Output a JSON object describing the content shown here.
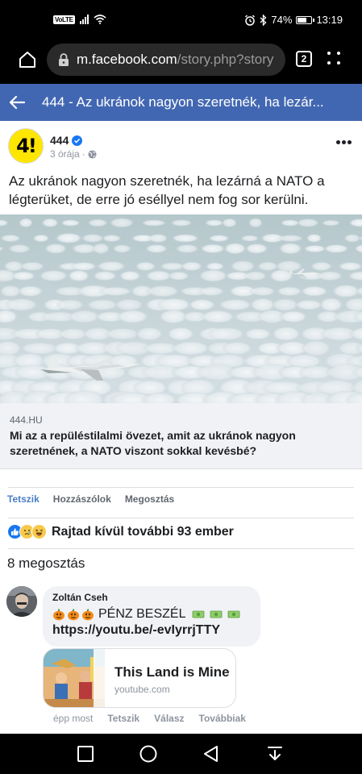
{
  "status_bar": {
    "volte": "VoLTE",
    "battery_text": "74%",
    "battery_level": 0.74,
    "time": "13:19"
  },
  "browser": {
    "url_host": "m.facebook.com",
    "url_path": "/story.php?story",
    "tab_count": "2"
  },
  "fb_header": {
    "title": "444 - Az ukránok nagyon szeretnék, ha lezár..."
  },
  "post": {
    "page_name": "444",
    "avatar_text": "4!",
    "time_ago": "3 órája",
    "separator": "·",
    "text": "Az ukránok nagyon szeretnék, ha lezárná a NATO a légterüket, de erre jó eséllyel nem fog sor kerülni.",
    "link_domain": "444.HU",
    "link_title": "Mi az a repüléstilalmi övezet, amit az ukránok nagyon szeretnének, a NATO viszont sokkal kevésbé?"
  },
  "actions": {
    "like": "Tetszik",
    "comment": "Hozzászólok",
    "share": "Megosztás"
  },
  "reactions": {
    "summary": "Rajtad kívül további 93 ember"
  },
  "shares": "8 megosztás",
  "comment": {
    "author": "Zoltán Cseh",
    "text": "PÉNZ BESZÉL",
    "link": "https://youtu.be/-evIyrrjTTY",
    "preview_title": "This Land is Mine",
    "preview_domain": "youtube.com",
    "time": "épp most",
    "like": "Tetszik",
    "reply": "Válasz",
    "more": "Továbbiak"
  },
  "colors": {
    "fb_blue": "#4267b2",
    "like_blue": "#4a7ec8",
    "avatar_yellow": "#ffe600"
  }
}
